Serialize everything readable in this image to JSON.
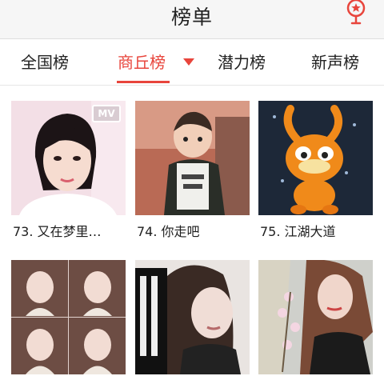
{
  "header": {
    "title": "榜单",
    "mic_icon": "microphone-star-icon",
    "accent": "#e8453c"
  },
  "tabs": [
    {
      "label": "全国榜",
      "active": false
    },
    {
      "label": "商丘榜",
      "active": true
    },
    {
      "label": "潜力榜",
      "active": false
    },
    {
      "label": "新声榜",
      "active": false
    }
  ],
  "items": [
    {
      "caption": "73. 又在梦里…",
      "badge": "MV"
    },
    {
      "caption": "74. 你走吧"
    },
    {
      "caption": "75. 江湖大道"
    },
    {
      "caption": ""
    },
    {
      "caption": ""
    },
    {
      "caption": ""
    }
  ]
}
